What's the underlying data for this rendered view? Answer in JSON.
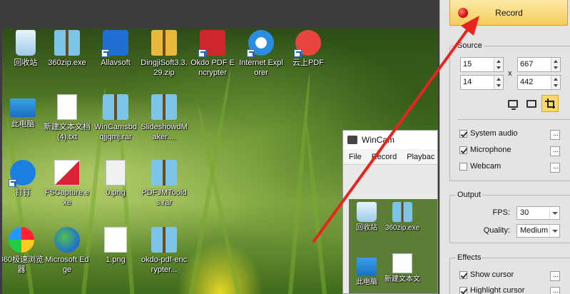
{
  "desktop": {
    "icons": [
      {
        "label": "回收站",
        "icon": "recycle-bin-icon"
      },
      {
        "label": "360zip.exe",
        "icon": "360zip-icon"
      },
      {
        "label": "Allavsoft",
        "icon": "allavsoft-icon"
      },
      {
        "label": "DingjiSoft3.3.29.zip",
        "icon": "zip-archive-icon"
      },
      {
        "label": "Okdo PDF Encrypter",
        "icon": "pdf-encrypter-icon"
      },
      {
        "label": "Internet Explorer",
        "icon": "internet-explorer-icon"
      },
      {
        "label": "云上PDF",
        "icon": "cloud-pdf-icon"
      },
      {
        "label": "此电脑",
        "icon": "this-pc-icon"
      },
      {
        "label": "新建文本文档 (4).txt",
        "icon": "text-file-icon"
      },
      {
        "label": "WinCamsbdqjjqmj.rar",
        "icon": "rar-archive-icon"
      },
      {
        "label": "SlideshowdMaker....",
        "icon": "rar-archive-icon"
      },
      {
        "label": "钉钉",
        "icon": "dingtalk-icon"
      },
      {
        "label": "FSCapture.exe",
        "icon": "fscapture-icon"
      },
      {
        "label": "0.png",
        "icon": "png-file-icon"
      },
      {
        "label": "PDFJMToolds.rar",
        "icon": "rar-archive-icon"
      },
      {
        "label": "360极速浏览器",
        "icon": "360-browser-icon"
      },
      {
        "label": "Microsoft Edge",
        "icon": "edge-icon"
      },
      {
        "label": "1.png",
        "icon": "png-file-icon"
      },
      {
        "label": "okdo-pdf-encrypter...",
        "icon": "rar-archive-icon"
      }
    ],
    "nested_window": {
      "title": "WinCam",
      "menu": [
        "File",
        "Record",
        "Playbac"
      ],
      "icons": [
        {
          "label": "回收站"
        },
        {
          "label": "360zip.exe"
        },
        {
          "label": "此电脑"
        },
        {
          "label": "新建文本文"
        }
      ]
    }
  },
  "panel": {
    "record_label": "Record",
    "source": {
      "title": "Source",
      "x": "15",
      "y": "14",
      "width": "667",
      "height": "442",
      "times": "x",
      "audio": [
        {
          "label": "System audio",
          "checked": true
        },
        {
          "label": "Microphone",
          "checked": true
        },
        {
          "label": "Webcam",
          "checked": false
        }
      ]
    },
    "output": {
      "title": "Output",
      "fps_label": "FPS:",
      "fps_value": "30",
      "quality_label": "Quality:",
      "quality_value": "Medium"
    },
    "effects": {
      "title": "Effects",
      "items": [
        {
          "label": "Show cursor",
          "checked": true
        },
        {
          "label": "Highlight cursor",
          "checked": true
        }
      ]
    }
  },
  "colors": {
    "record_button": "#f6cd5c",
    "arrow": "#e8241c",
    "panel_bg": "#e4e4e4"
  }
}
